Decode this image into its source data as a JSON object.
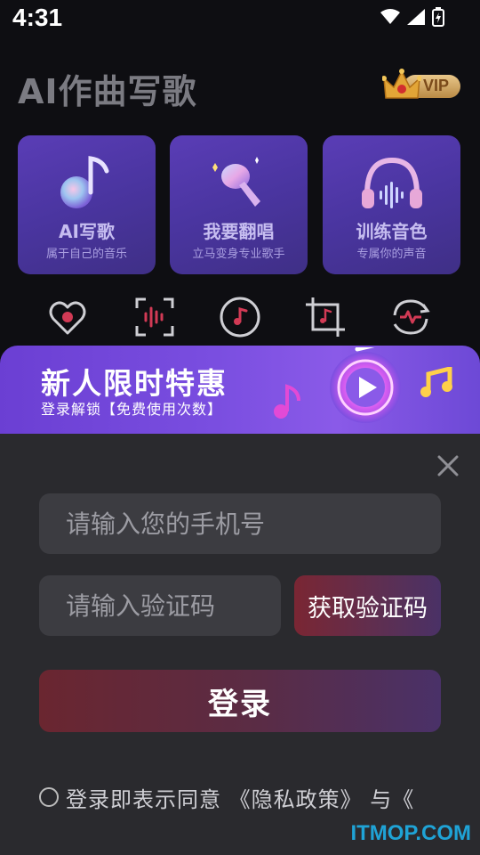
{
  "status": {
    "time": "4:31"
  },
  "header": {
    "app_title": "AI作曲写歌",
    "vip_label": "VIP"
  },
  "feature_cards": [
    {
      "title": "AI写歌",
      "subtitle": "属于自己的音乐",
      "icon": "music-note-icon"
    },
    {
      "title": "我要翻唱",
      "subtitle": "立马变身专业歌手",
      "icon": "microphone-icon"
    },
    {
      "title": "训练音色",
      "subtitle": "专属你的声音",
      "icon": "headphones-icon"
    }
  ],
  "tools": [
    {
      "icon": "heart-icon"
    },
    {
      "icon": "voice-scan-icon"
    },
    {
      "icon": "music-disc-icon"
    },
    {
      "icon": "crop-music-icon"
    },
    {
      "icon": "audio-refresh-icon"
    }
  ],
  "promo": {
    "title": "新人限时特惠",
    "subtitle": "登录解锁【免费使用次数】"
  },
  "login": {
    "phone_placeholder": "请输入您的手机号",
    "code_placeholder": "请输入验证码",
    "get_code_label": "获取验证码",
    "login_label": "登录",
    "agreement_text": "登录即表示同意 《隐私政策》 与《"
  },
  "watermark": "ITMOP.COM",
  "colors": {
    "card_purple": "#4a35a0",
    "promo_purple": "#7a4ee0",
    "sheet_bg": "#2a2a2e",
    "login_red": "#6a2630"
  }
}
